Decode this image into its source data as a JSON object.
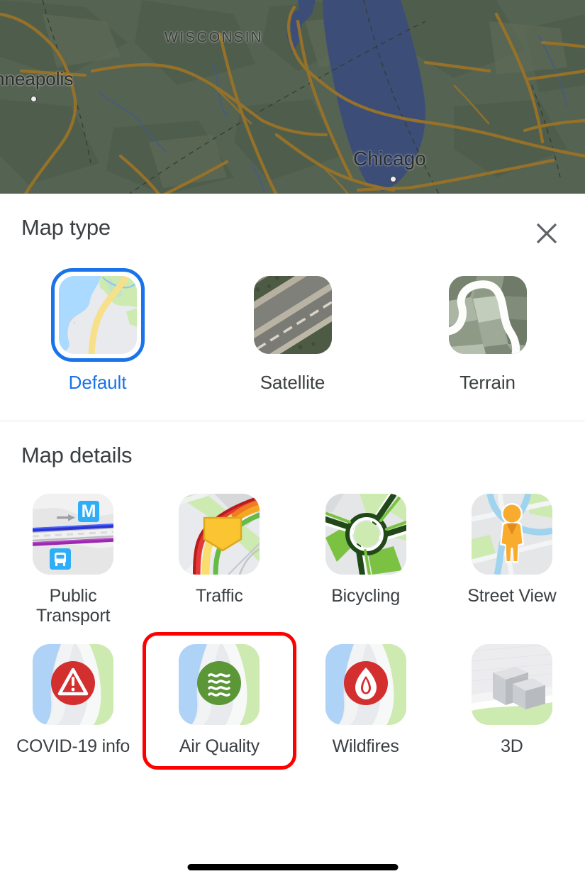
{
  "map_backdrop": {
    "labels": [
      {
        "id": "wisconsin",
        "text": "WISCONSIN"
      },
      {
        "id": "minneapolis",
        "text": "nneapolis"
      },
      {
        "id": "chicago",
        "text": "Chicago"
      }
    ],
    "water_color": "#4a5f9e",
    "land_color": "#5f6f5f",
    "road_color": "#c9912f"
  },
  "sheet": {
    "map_type": {
      "title": "Map type",
      "close_icon": "close-icon",
      "options": [
        {
          "id": "default",
          "label": "Default",
          "icon": "map-default-thumbnail",
          "selected": true
        },
        {
          "id": "satellite",
          "label": "Satellite",
          "icon": "map-satellite-thumbnail",
          "selected": false
        },
        {
          "id": "terrain",
          "label": "Terrain",
          "icon": "map-terrain-thumbnail",
          "selected": false
        }
      ],
      "selected_color": "#1a73e8"
    },
    "map_details": {
      "title": "Map details",
      "highlight_color": "#ff0000",
      "items": [
        {
          "id": "public-transport",
          "label": "Public Transport",
          "icon": "public-transport-thumbnail",
          "highlighted": false
        },
        {
          "id": "traffic",
          "label": "Traffic",
          "icon": "traffic-thumbnail",
          "highlighted": false
        },
        {
          "id": "bicycling",
          "label": "Bicycling",
          "icon": "bicycling-thumbnail",
          "highlighted": false
        },
        {
          "id": "street-view",
          "label": "Street View",
          "icon": "street-view-thumbnail",
          "highlighted": false
        },
        {
          "id": "covid-19-info",
          "label": "COVID-19 info",
          "icon": "covid-info-thumbnail",
          "highlighted": false
        },
        {
          "id": "air-quality",
          "label": "Air Quality",
          "icon": "air-quality-thumbnail",
          "highlighted": true
        },
        {
          "id": "wildfires",
          "label": "Wildfires",
          "icon": "wildfires-thumbnail",
          "highlighted": false
        },
        {
          "id": "3d",
          "label": "3D",
          "icon": "3d-buildings-thumbnail",
          "highlighted": false
        }
      ]
    }
  }
}
